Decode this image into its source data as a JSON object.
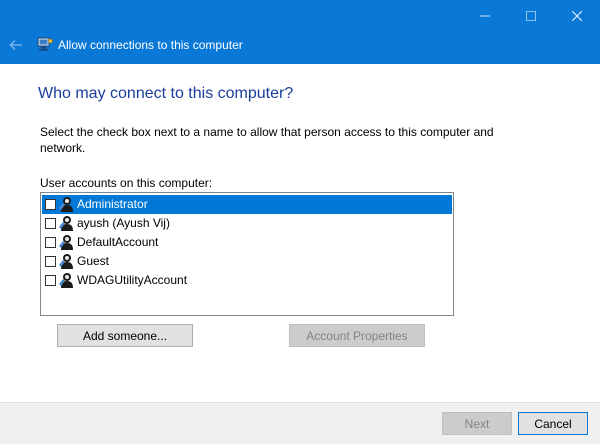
{
  "window": {
    "title": "Allow connections to this computer"
  },
  "content": {
    "heading": "Who may connect to this computer?",
    "instruction": "Select the check box next to a name to allow that person access to this computer and network.",
    "list_label": "User accounts on this computer:"
  },
  "accounts": [
    {
      "name": "Administrator",
      "checked": false,
      "selected": true
    },
    {
      "name": "ayush (Ayush Vij)",
      "checked": false,
      "selected": false
    },
    {
      "name": "DefaultAccount",
      "checked": false,
      "selected": false
    },
    {
      "name": "Guest",
      "checked": false,
      "selected": false
    },
    {
      "name": "WDAGUtilityAccount",
      "checked": false,
      "selected": false
    }
  ],
  "buttons": {
    "add_someone": "Add someone...",
    "account_properties": "Account Properties",
    "next": "Next",
    "cancel": "Cancel"
  },
  "colors": {
    "titlebar": "#0a78d7",
    "heading": "#1a3e9c",
    "selection": "#0078d7"
  },
  "icons": {
    "back": "back-arrow-icon",
    "app": "network-computer-icon",
    "user": "user-account-icon"
  }
}
